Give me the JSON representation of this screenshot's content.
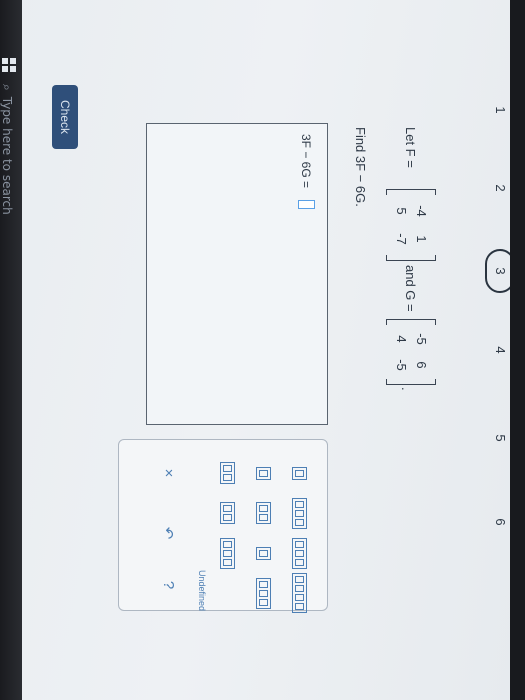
{
  "taskbar": {
    "search_placeholder": "Type here to search",
    "search_glyph": "⌕"
  },
  "steps": [
    "1",
    "2",
    "3",
    "4",
    "5",
    "6"
  ],
  "active_step": "3",
  "problem": {
    "let_text": "Let F =",
    "F": [
      [
        "-4",
        "1"
      ],
      [
        "5",
        "-7"
      ]
    ],
    "and_text": "and G =",
    "G": [
      [
        "-5",
        "6"
      ],
      [
        "4",
        "-5"
      ]
    ],
    "period": ".",
    "find_text": "Find 3F − 6G."
  },
  "answer": {
    "label": "3F − 6G ="
  },
  "palette": {
    "undefined_label": "Undefined",
    "clear": "×",
    "undo": "↶",
    "help": "?"
  },
  "check_label": "Check"
}
